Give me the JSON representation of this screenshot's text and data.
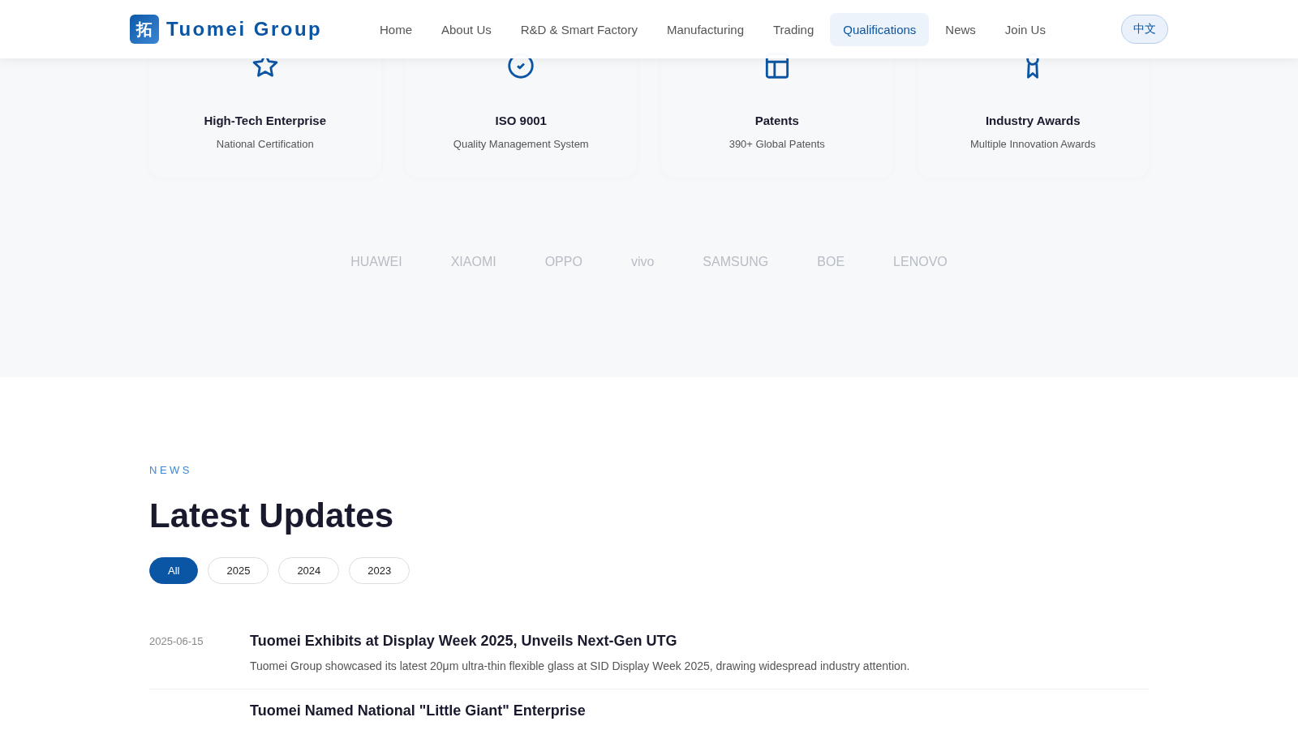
{
  "header": {
    "logo_mark": "拓",
    "brand": "Tuomei Group",
    "nav": [
      {
        "label": "Home",
        "selected": false
      },
      {
        "label": "About Us",
        "selected": false
      },
      {
        "label": "R&D & Smart Factory",
        "selected": false
      },
      {
        "label": "Manufacturing",
        "selected": false
      },
      {
        "label": "Trading",
        "selected": false
      },
      {
        "label": "Qualifications",
        "selected": true
      },
      {
        "label": "News",
        "selected": false
      },
      {
        "label": "Join Us",
        "selected": false
      }
    ],
    "language_button": "中文"
  },
  "qualifications": [
    {
      "kind": "star",
      "title": "High-Tech Enterprise",
      "subtitle": "National Certification"
    },
    {
      "kind": "check",
      "title": "ISO 9001",
      "subtitle": "Quality Management System"
    },
    {
      "kind": "patent",
      "title": "Patents",
      "subtitle": "390+ Global Patents"
    },
    {
      "kind": "award",
      "title": "Industry Awards",
      "subtitle": "Multiple Innovation Awards"
    }
  ],
  "partners": [
    "HUAWEI",
    "XIAOMI",
    "OPPO",
    "vivo",
    "SAMSUNG",
    "BOE",
    "LENOVO"
  ],
  "news": {
    "eyebrow": "NEWS",
    "heading": "Latest Updates",
    "filters": [
      {
        "label": "All",
        "selected": true
      },
      {
        "label": "2025",
        "selected": false
      },
      {
        "label": "2024",
        "selected": false
      },
      {
        "label": "2023",
        "selected": false
      }
    ],
    "items": [
      {
        "date": "2025-06-15",
        "title": "Tuomei Exhibits at Display Week 2025, Unveils Next-Gen UTG",
        "summary": "Tuomei Group showcased its latest 20μm ultra-thin flexible glass at SID Display Week 2025, drawing widespread industry attention."
      },
      {
        "title": "Tuomei Named National \"Little Giant\" Enterprise"
      }
    ]
  }
}
